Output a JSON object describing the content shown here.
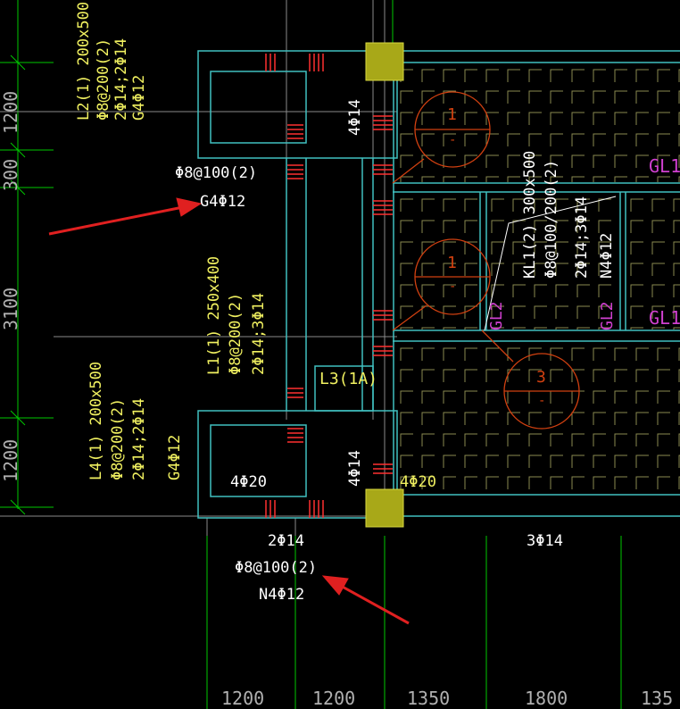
{
  "colors": {
    "background": "#000000",
    "grid": "#00d000",
    "beam": "#40c0c0",
    "rebar": "#ff3030",
    "annotation_yellow": "#f0f060",
    "annotation_white": "#ffffff",
    "column": "#a8a818",
    "slab_hatch": "#8a8a50",
    "marker_circle": "#d04010",
    "gl_magenta": "#d040d0",
    "arrow": "#e02020"
  },
  "left_dimensions": [
    "1200",
    "300",
    "3100",
    "1200"
  ],
  "bottom_dimensions": [
    "1200",
    "1200",
    "1350",
    "1800",
    "135"
  ],
  "beams": {
    "l2": {
      "name": "L2(1) 200x500",
      "stirrup": "Φ8@200(2)",
      "main": "2Φ14;2Φ14",
      "side": "G4Φ12"
    },
    "l1": {
      "name": "L1(1) 250x400",
      "stirrup": "Φ8@200(2)",
      "main": "2Φ14;3Φ14"
    },
    "l4": {
      "name": "L4(1) 200x500",
      "stirrup": "Φ8@200(2)",
      "main": "2Φ14;2Φ14",
      "side": "G4Φ12"
    },
    "kl1": {
      "name": "KL1(2) 300x500",
      "stirrup": "Φ8@100/200(2)",
      "main": "2Φ14;3Φ14",
      "side": "N4Φ12"
    },
    "l3": "L3(1A)"
  },
  "labels": {
    "top_stirrup": "Φ8@100(2)",
    "top_side": "G4Φ12",
    "vert_4phi14_top": "4Φ14",
    "vert_4phi14_bottom": "4Φ14",
    "bottom_4phi20": "4Φ20",
    "bottom_4phi20_right": "4Φ20",
    "bottom_2phi14": "2Φ14",
    "bottom_stirrup": "Φ8@100(2)",
    "bottom_side": "N4Φ12",
    "right_3phi14": "3Φ14",
    "gl2_left": "GL2",
    "gl2_right": "GL2",
    "gl1_top": "GL1",
    "gl1_mid": "GL1"
  },
  "markers": [
    {
      "top": "1",
      "bottom": "-"
    },
    {
      "top": "1",
      "bottom": "-"
    },
    {
      "top": "3",
      "bottom": "-"
    }
  ]
}
